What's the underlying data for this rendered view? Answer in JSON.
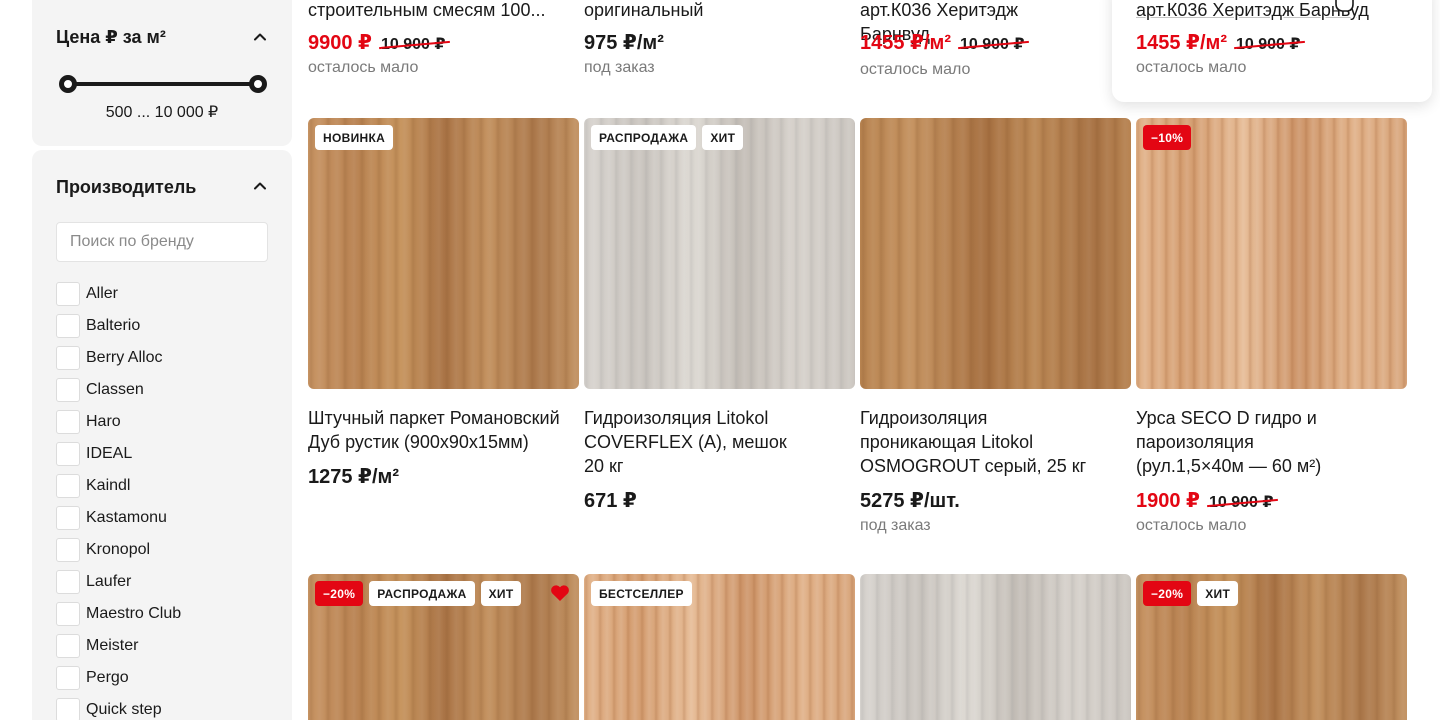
{
  "filters": {
    "price": {
      "title": "Цена ₽ за м²",
      "range_label": "500 ... 10 000 ₽",
      "min_value": 500,
      "max_value": 10000
    },
    "brand": {
      "title": "Производитель",
      "search_placeholder": "Поиск по бренду",
      "items": [
        {
          "label": "Aller"
        },
        {
          "label": "Balterio"
        },
        {
          "label": "Berry Alloc"
        },
        {
          "label": "Classen"
        },
        {
          "label": "Haro"
        },
        {
          "label": "IDEAL"
        },
        {
          "label": "Kaindl"
        },
        {
          "label": "Kastamonu"
        },
        {
          "label": "Kronopol"
        },
        {
          "label": "Laufer"
        },
        {
          "label": "Maestro Club"
        },
        {
          "label": "Meister"
        },
        {
          "label": "Pergo"
        },
        {
          "label": "Quick step"
        }
      ]
    }
  },
  "top_row": [
    {
      "title": "строительным смесям 100...",
      "price": "9900 ₽",
      "old_price": "10 900 ₽",
      "stock": "осталось мало"
    },
    {
      "title": "оригинальный",
      "price": "975 ₽/м²",
      "stock": "под заказ"
    },
    {
      "title": "арт.К036 Херитэдж Барнвуд",
      "price": "1455 ₽/м²",
      "old_price": "10 900 ₽",
      "stock": "осталось мало"
    },
    {
      "title": "арт.К036 Херитэдж Барнвуд",
      "price": "1455 ₽/м²",
      "old_price": "10 900 ₽",
      "stock": "осталось мало"
    }
  ],
  "products": [
    {
      "badges": [
        "НОВИНКА"
      ],
      "title": "Штучный паркет Романовский Дуб рустик (900х90х15мм)",
      "price": "1275 ₽/м²"
    },
    {
      "badges": [
        "РАСПРОДАЖА",
        "ХИТ"
      ],
      "title": "Гидроизоляция Litokol COVERFLEX (A), мешок 20 кг",
      "price": "671 ₽"
    },
    {
      "badges": [],
      "title": "Гидроизоляция проникающая Litokol OSMOGROUT серый, 25 кг",
      "price": "5275 ₽/шт.",
      "stock": "под заказ"
    },
    {
      "badges": [
        "−10%"
      ],
      "title": "Урса SECO D гидро и пароизоляция (рул.1,5×40м — 60 м²)",
      "price": "1900 ₽",
      "old_price": "10 900 ₽",
      "stock": "осталось мало"
    }
  ],
  "bottom_row": [
    {
      "badges": [
        "−20%",
        "РАСПРОДАЖА",
        "ХИТ"
      ],
      "favorite": true
    },
    {
      "badges": [
        "БЕСТСЕЛЛЕР"
      ]
    },
    {
      "badges": []
    },
    {
      "badges": [
        "−20%",
        "ХИТ"
      ]
    }
  ],
  "colors": {
    "accent_red": "#e30613",
    "panel_bg": "#f4f4f4",
    "muted_text": "#7a7a7a"
  }
}
